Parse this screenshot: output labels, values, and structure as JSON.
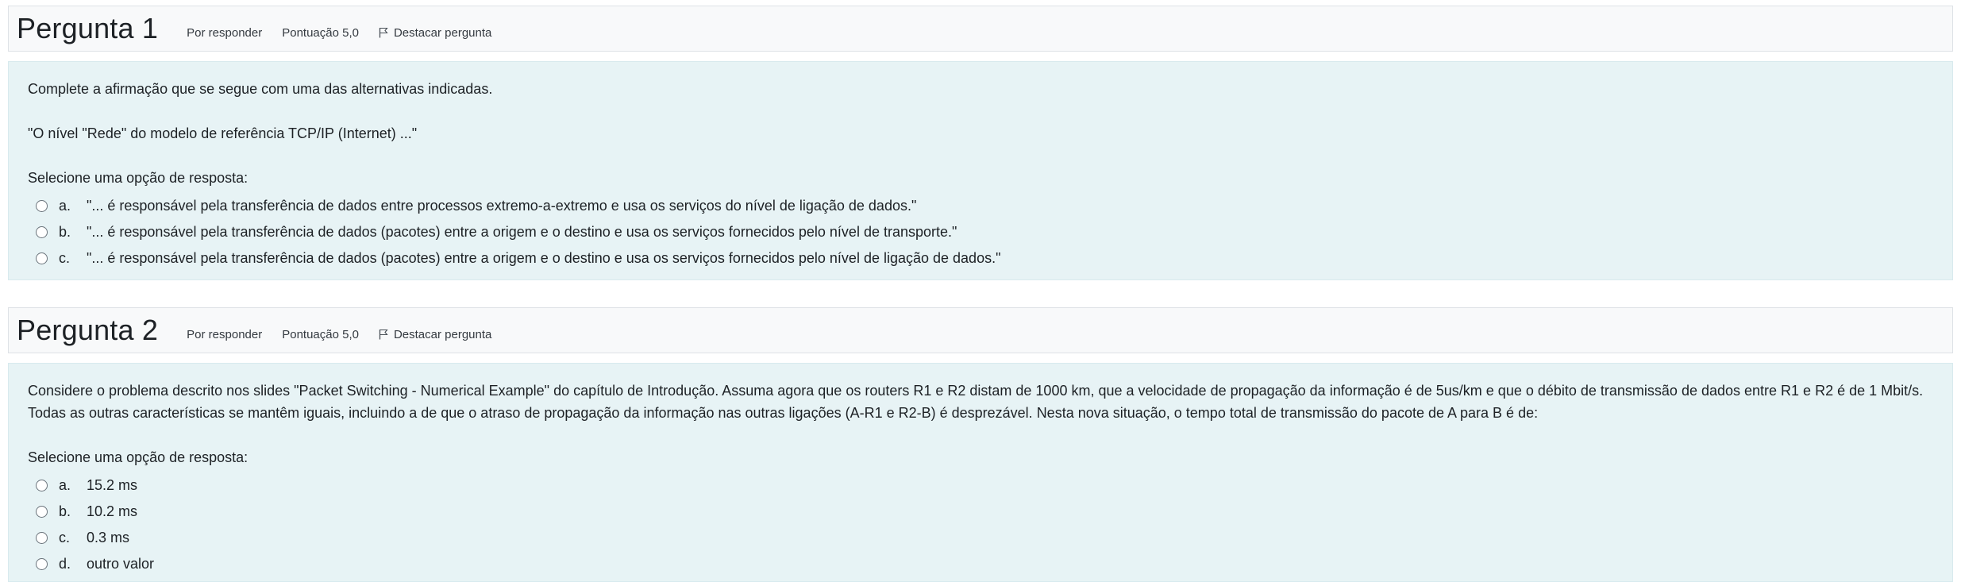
{
  "questions": [
    {
      "title_word": "Pergunta",
      "number": "1",
      "status": "Por responder",
      "score": "Pontuação 5,0",
      "flag_label": "Destacar pergunta",
      "text": [
        "Complete a afirmação que se segue com uma das alternativas indicadas.",
        "\"O nível \"Rede\" do modelo de referência TCP/IP (Internet) ...\""
      ],
      "prompt": "Selecione uma opção de resposta:",
      "answers": [
        {
          "letter": "a.",
          "text": "\"... é responsável pela transferência de dados entre processos extremo-a-extremo e usa os serviços do nível de ligação de dados.\""
        },
        {
          "letter": "b.",
          "text": "\"... é responsável pela transferência de dados (pacotes) entre a origem e o destino e usa os serviços fornecidos pelo nível de transporte.\""
        },
        {
          "letter": "c.",
          "text": "\"... é responsável pela transferência de dados (pacotes) entre a origem e o destino e usa os serviços fornecidos pelo nível de ligação de dados.\""
        }
      ]
    },
    {
      "title_word": "Pergunta",
      "number": "2",
      "status": "Por responder",
      "score": "Pontuação 5,0",
      "flag_label": "Destacar pergunta",
      "text": [
        "Considere o problema descrito nos slides \"Packet Switching - Numerical Example\" do capítulo de Introdução. Assuma agora que os routers R1 e R2 distam de 1000 km, que a velocidade de propagação da informação é de 5us/km e que o débito de transmissão de dados entre R1 e R2 é de 1 Mbit/s. Todas as outras características se mantêm iguais, incluindo a de que o atraso de propagação da informação nas outras ligações (A-R1 e R2-B) é desprezável. Nesta nova situação, o tempo total de transmissão do pacote de A para B é de:"
      ],
      "prompt": "Selecione uma opção de resposta:",
      "answers": [
        {
          "letter": "a.",
          "text": "15.2 ms"
        },
        {
          "letter": "b.",
          "text": "10.2 ms"
        },
        {
          "letter": "c.",
          "text": "0.3 ms"
        },
        {
          "letter": "d.",
          "text": "outro valor"
        }
      ]
    }
  ]
}
